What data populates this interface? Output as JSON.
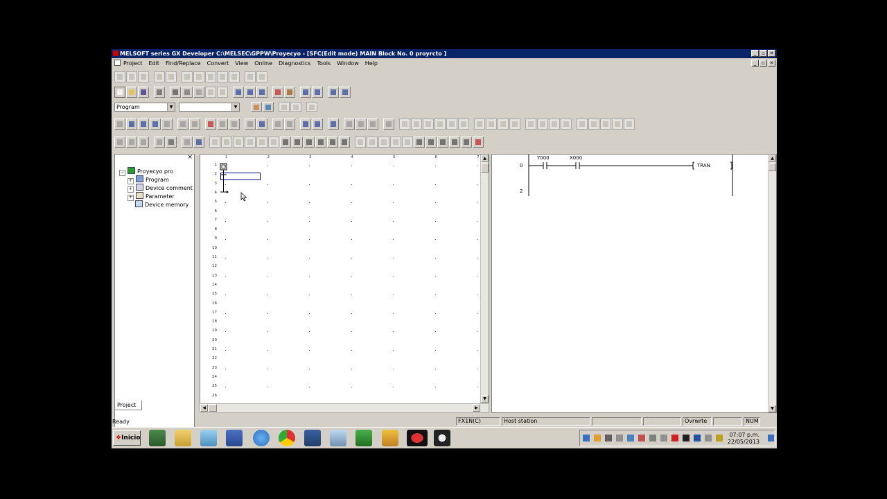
{
  "window": {
    "title": "MELSOFT series GX Developer C:\\MELSEC\\GPPW\\Proyecyo - [SFC(Edit mode)   MAIN   Block No.   0  proyrcto  ]"
  },
  "window_buttons": {
    "minimize": "_",
    "restore": "▫",
    "close": "✕"
  },
  "menu": [
    "Project",
    "Edit",
    "Find/Replace",
    "Convert",
    "View",
    "Online",
    "Diagnostics",
    "Tools",
    "Window",
    "Help"
  ],
  "toolbar": {
    "program_combo_value": "Program",
    "second_combo_value": ""
  },
  "project_panel": {
    "close_label": "×",
    "root": "Proyecyo pro",
    "items": [
      "Program",
      "Device comment",
      "Parameter",
      "Device memory"
    ],
    "tab_label": "Project"
  },
  "sfc": {
    "col_numbers": [
      "1",
      "2",
      "3",
      "4",
      "5",
      "6",
      "7"
    ],
    "row_numbers": [
      "1",
      "2",
      "3",
      "4",
      "5",
      "6",
      "7",
      "8",
      "9",
      "10",
      "11",
      "12",
      "13",
      "14",
      "15",
      "16",
      "17",
      "18",
      "19",
      "20",
      "21",
      "22",
      "23",
      "24",
      "25",
      "26"
    ]
  },
  "ladder": {
    "contacts": [
      "Y000",
      "X000"
    ],
    "rungs": [
      "0",
      "2"
    ],
    "coil": "TRAN"
  },
  "status": {
    "ready": "Ready",
    "plc": "FX1N(C)",
    "station": "Host station",
    "mode": "Ovrwrte",
    "num": "NUM"
  },
  "taskbar": {
    "start_label": "Inicio",
    "time": "07:07 p.m.",
    "date": "22/05/2013"
  }
}
